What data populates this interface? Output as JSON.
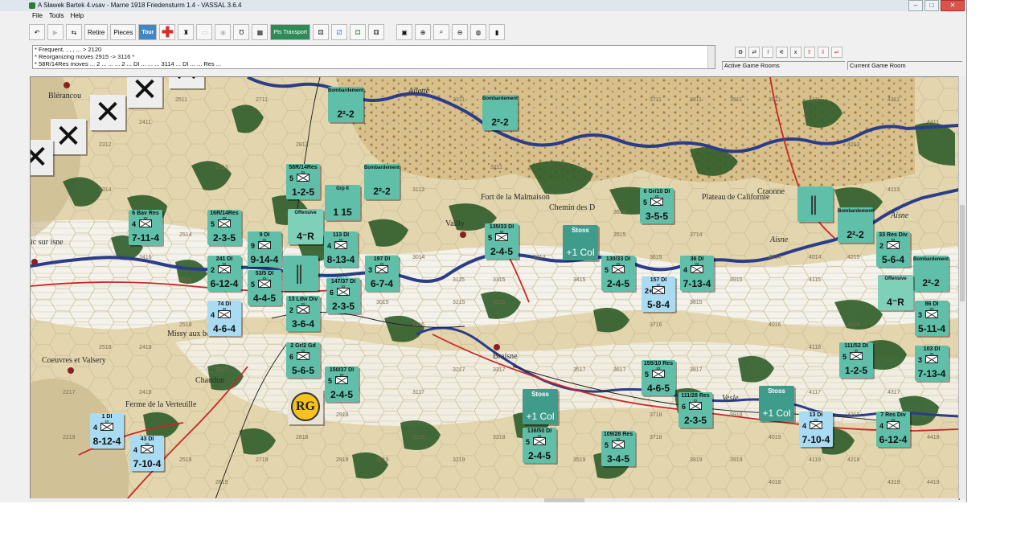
{
  "window": {
    "title": "A Sławek Bartek 4.vsav - Marne 1918 Friedensturm 1.4 - VASSAL 3.6.4"
  },
  "menu": [
    "File",
    "Tools",
    "Help"
  ],
  "toolbar": {
    "retire_label": "Retire",
    "pieces_label": "Pieces",
    "tour_label": "Tour",
    "pts_label": "Pts Transport"
  },
  "chat": {
    "lines": [
      "* Frequent, , , , ... > 2120",
      "* Reorganizing moves 2915 -> 3116 *",
      "* 58R/14Res moves ... 2 ... ... ... 2 ... DI ... ... ... 3114 ... DI ... ... Res ..."
    ]
  },
  "rooms": {
    "active_label": "Active Game Rooms",
    "current_label": "Current Game Room"
  },
  "hexes": [
    "2511",
    "2411",
    "2312",
    "2711",
    "2813",
    "3311",
    "2713",
    "3113",
    "3211",
    "2314",
    "2514",
    "2516",
    "2416",
    "2518",
    "2614",
    "2616",
    "2816",
    "3115",
    "3014",
    "3015",
    "3216",
    "3314",
    "3415",
    "3515",
    "3615",
    "3515",
    "3714",
    "3815",
    "3915",
    "4014",
    "4115",
    "4215",
    "3215",
    "3315",
    "3116",
    "3716",
    "4016",
    "4118",
    "4315",
    "4216",
    "4311",
    "4411",
    "3711",
    "3811",
    "3911",
    "4111",
    "4213",
    "2217",
    "2418",
    "2617",
    "2816",
    "2918",
    "3117",
    "3217",
    "3317",
    "3418",
    "3517",
    "3617",
    "3718",
    "3817",
    "3918",
    "4019",
    "4117",
    "4218",
    "4317",
    "4418",
    "2219",
    "2419",
    "2519",
    "2619",
    "2719",
    "2818",
    "2919",
    "3019",
    "3118",
    "3219",
    "3318",
    "3419",
    "3519",
    "3619",
    "3718",
    "3819",
    "3919",
    "4018",
    "4119",
    "4218",
    "4319",
    "4419",
    "2418",
    "2518",
    "3911",
    "4113",
    "4014",
    "3614"
  ],
  "places": [
    {
      "label": "Blérancou"
    },
    {
      "label": "Vailly"
    },
    {
      "label": "Fort de la Malmaison"
    },
    {
      "label": "Chemin des D"
    },
    {
      "label": "Plateau de Californie"
    },
    {
      "label": "Craonne"
    },
    {
      "label": "Aisne"
    },
    {
      "label": "Aisne"
    },
    {
      "label": "Ailette"
    },
    {
      "label": "Missy aux bois"
    },
    {
      "label": "Coeuvres et Valsery"
    },
    {
      "label": "Chaudun"
    },
    {
      "label": "Braisne"
    },
    {
      "label": "Vesle"
    },
    {
      "label": "Ferme de la Verteuille"
    },
    {
      "label": "ic sur isne"
    }
  ],
  "units": [
    {
      "name": "58R/14Res",
      "size": "5",
      "stats": "1-2-5",
      "color": "t"
    },
    {
      "name": "6 Bav Res",
      "size": "4",
      "stats": "7-11-4",
      "color": "t"
    },
    {
      "name": "16R/14Res",
      "size": "5",
      "stats": "2-3-5",
      "color": "t"
    },
    {
      "name": "9 DI",
      "size": "9",
      "stats": "9-14-4",
      "color": "t"
    },
    {
      "name": "113 DI",
      "size": "4",
      "stats": "8-13-4",
      "color": "t"
    },
    {
      "name": "241 DI",
      "size": "2",
      "stats": "6-12-4",
      "color": "t"
    },
    {
      "name": "53/5 DI",
      "size": "5",
      "stats": "4-4-5",
      "color": "t"
    },
    {
      "name": "147/37 DI",
      "size": "6",
      "stats": "2-3-5",
      "color": "t"
    },
    {
      "name": "197 DI",
      "size": "3",
      "stats": "6-7-4",
      "color": "t"
    },
    {
      "name": "74 DI",
      "size": "4",
      "stats": "4-6-4",
      "color": "lb"
    },
    {
      "name": "13 Ldw Div",
      "size": "2",
      "stats": "3-6-4",
      "color": "t"
    },
    {
      "name": "2 Gr/2 Gd",
      "size": "6",
      "stats": "5-6-5",
      "color": "t"
    },
    {
      "name": "150/37 DI",
      "size": "5",
      "stats": "2-4-5",
      "color": "t"
    },
    {
      "name": "135/33 DI",
      "size": "5",
      "stats": "2-4-5",
      "color": "t"
    },
    {
      "name": "130/33 DI",
      "size": "5",
      "stats": "2-4-5",
      "color": "t"
    },
    {
      "name": "157 DI",
      "size": "2+",
      "stats": "5-8-4",
      "color": "lb"
    },
    {
      "name": "36 DI",
      "size": "4",
      "stats": "7-13-4",
      "color": "t"
    },
    {
      "name": "6 Gr/10 DI",
      "size": "5",
      "stats": "3-5-5",
      "color": "t"
    },
    {
      "name": "33 Res Div",
      "size": "2",
      "stats": "5-6-4",
      "color": "t"
    },
    {
      "name": "86 DI",
      "size": "3",
      "stats": "5-11-4",
      "color": "t"
    },
    {
      "name": "111/52 DI",
      "size": "5",
      "stats": "1-2-5",
      "color": "t"
    },
    {
      "name": "103 DI",
      "size": "3",
      "stats": "7-13-4",
      "color": "t"
    },
    {
      "name": "155/10 Res",
      "size": "5",
      "stats": "4-6-5",
      "color": "t"
    },
    {
      "name": "111/28 Res",
      "size": "6",
      "stats": "2-3-5",
      "color": "t"
    },
    {
      "name": "138/50 DI",
      "size": "5",
      "stats": "2-4-5",
      "color": "t"
    },
    {
      "name": "109/28 Res",
      "size": "5",
      "stats": "3-4-5",
      "color": "t"
    },
    {
      "name": "13 DI",
      "size": "4",
      "stats": "7-10-4",
      "color": "lb"
    },
    {
      "name": "7 Res Div",
      "size": "4",
      "stats": "6-12-4",
      "color": "t"
    },
    {
      "name": "1 DI",
      "size": "4",
      "stats": "8-12-4",
      "color": "lb"
    },
    {
      "name": "43 DI",
      "size": "4",
      "stats": "7-10-4",
      "color": "lb"
    }
  ],
  "markers": [
    {
      "title": "Bombardement",
      "value": "2²-2",
      "kind": "bomb"
    },
    {
      "title": "Bombardement",
      "value": "2²-2",
      "kind": "bomb"
    },
    {
      "title": "Bombardement",
      "value": "2²-2",
      "kind": "bomb"
    },
    {
      "title": "Bombardement",
      "value": "2²-2",
      "kind": "bomb"
    },
    {
      "title": "Bombardement",
      "value": "2²-2",
      "kind": "bomb"
    },
    {
      "title": "Grp II",
      "value": "1 15",
      "kind": "air"
    },
    {
      "title": "Offensive",
      "value": "4⁻R",
      "kind": "off"
    },
    {
      "title": "Offensive",
      "value": "4⁻R",
      "kind": "off"
    },
    {
      "title": "Stoss",
      "value": "+1 Col",
      "kind": "stoss"
    },
    {
      "title": "Stoss",
      "value": "+1 Col",
      "kind": "stoss"
    },
    {
      "title": "Stoss",
      "value": "+1 Col",
      "kind": "stoss"
    },
    {
      "title": "",
      "value": "",
      "kind": "hq"
    },
    {
      "title": "",
      "value": "",
      "kind": "hq"
    }
  ],
  "rg_label": "RG",
  "colors": {
    "river": "#2b3d8a",
    "road": "#c62828",
    "rail": "#222222",
    "forest": "#2f5d2a",
    "counter": "#5fbfa8",
    "counter_light": "#a9dcf2"
  }
}
